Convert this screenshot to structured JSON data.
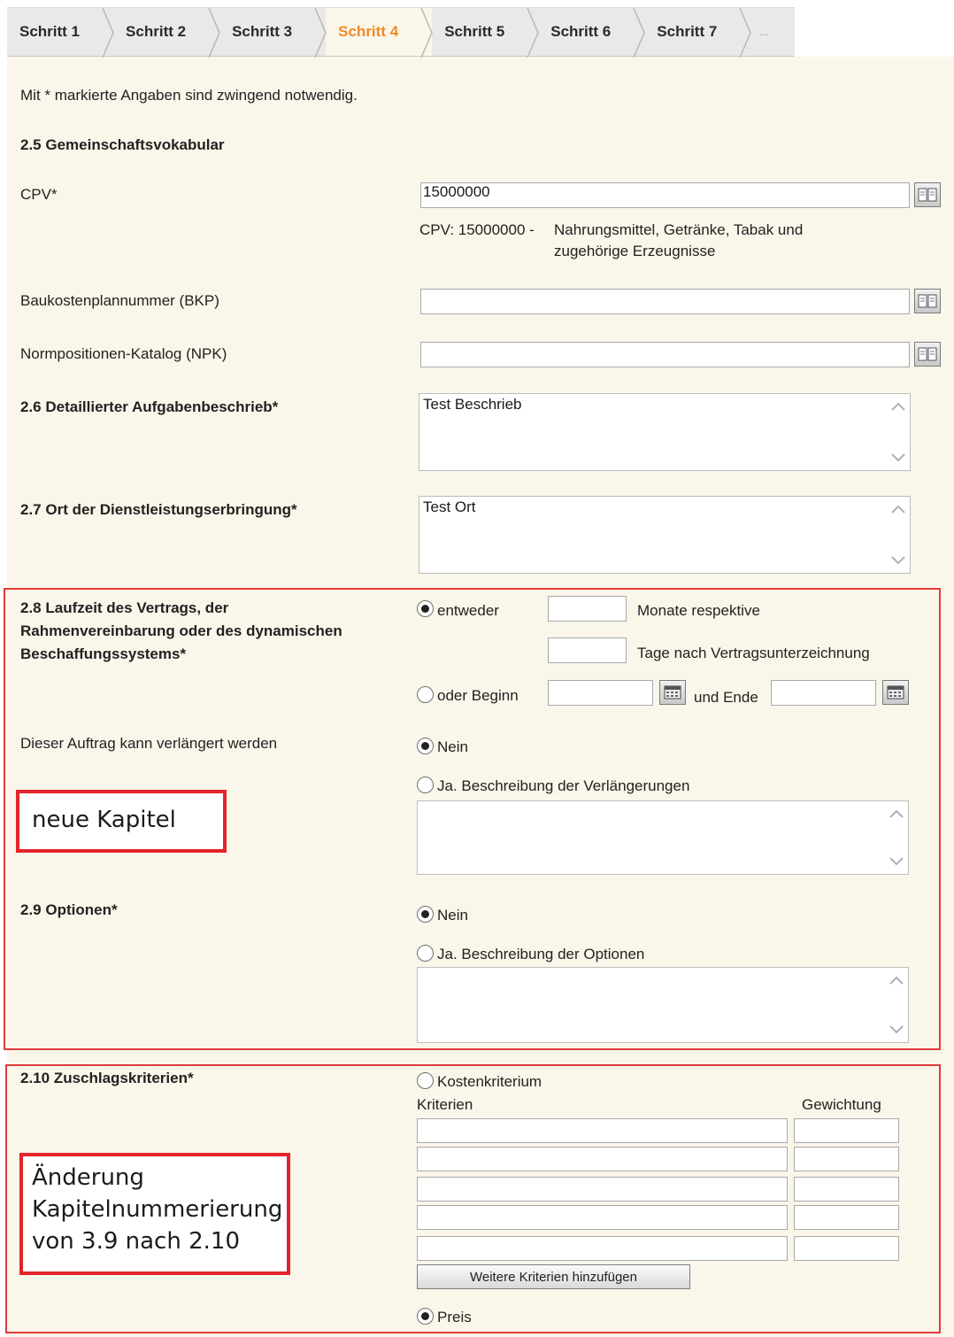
{
  "steps": [
    "Schritt 1",
    "Schritt 2",
    "Schritt 3",
    "Schritt 4",
    "Schritt 5",
    "Schritt 6",
    "Schritt 7",
    "..."
  ],
  "active_step": "Schritt 4",
  "colors": {
    "active_tab": "#f08a24",
    "panel_bg": "#fbf6ea",
    "highlight_border": "#e03a3a"
  },
  "required_note": "Mit * markierte Angaben sind zwingend notwendig.",
  "section_25": {
    "heading": "2.5 Gemeinschaftsvokabular",
    "cpv_label": "CPV*",
    "cpv_value": "15000000",
    "cpv_desc_code": "CPV: 15000000 -",
    "cpv_desc_text_1": "Nahrungsmittel, Getränke, Tabak und",
    "cpv_desc_text_2": "zugehörige Erzeugnisse",
    "bkp_label": "Baukostenplannummer (BKP)",
    "bkp_value": "",
    "npk_label": "Normpositionen-Katalog (NPK)",
    "npk_value": ""
  },
  "section_26": {
    "label": "2.6 Detaillierter Aufgabenbeschrieb*",
    "value": "Test Beschrieb"
  },
  "section_27": {
    "label": "2.7 Ort der Dienstleistungserbringung*",
    "value": "Test Ort"
  },
  "section_28": {
    "label_1": "2.8 Laufzeit des Vertrags, der",
    "label_2": "Rahmenvereinbarung oder des dynamischen",
    "label_3": "Beschaffungssystems*",
    "option_either": "entweder",
    "months_label": "Monate respektive",
    "days_label": "Tage nach Vertragsunterzeichnung",
    "option_start": "oder Beginn",
    "end_label": "und Ende",
    "selected": "entweder",
    "extend_label": "Dieser Auftrag kann verlängert werden",
    "extend_no": "Nein",
    "extend_yes": "Ja. Beschreibung der Verlängerungen",
    "extend_selected": "Nein"
  },
  "callout_new": "neue Kapitel",
  "section_29": {
    "label": "2.9 Optionen*",
    "no": "Nein",
    "yes": "Ja. Beschreibung der Optionen",
    "selected": "Nein"
  },
  "section_210": {
    "label": "2.10 Zuschlagskriterien*",
    "cost_criterion": "Kostenkriterium",
    "criteria_header": "Kriterien",
    "weight_header": "Gewichtung",
    "rows": [
      {
        "criterion": "",
        "weight": ""
      },
      {
        "criterion": "",
        "weight": ""
      },
      {
        "criterion": "",
        "weight": ""
      },
      {
        "criterion": "",
        "weight": ""
      },
      {
        "criterion": "",
        "weight": ""
      }
    ],
    "add_button": "Weitere Kriterien hinzufügen",
    "price": "Preis",
    "selected": "Preis"
  },
  "callout_renumber": {
    "line1": "Änderung",
    "line2": "Kapitelnummerierung",
    "line3": "von 3.9 nach 2.10"
  }
}
